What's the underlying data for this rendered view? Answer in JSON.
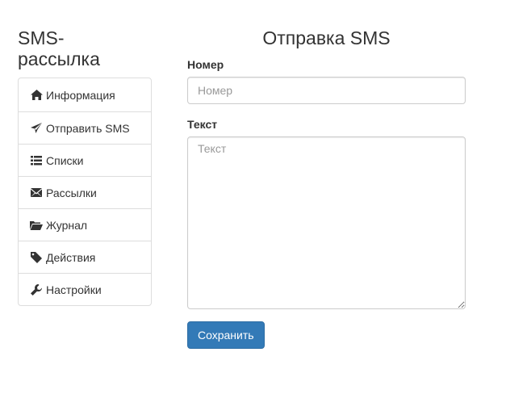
{
  "app": {
    "title": "SMS-рассылка"
  },
  "sidebar": {
    "items": [
      {
        "label": "Информация",
        "icon": "home-icon"
      },
      {
        "label": "Отправить SMS",
        "icon": "send-icon"
      },
      {
        "label": "Списки",
        "icon": "list-icon"
      },
      {
        "label": "Рассылки",
        "icon": "envelope-icon"
      },
      {
        "label": "Журнал",
        "icon": "folder-open-icon"
      },
      {
        "label": "Действия",
        "icon": "tag-icon"
      },
      {
        "label": "Настройки",
        "icon": "wrench-icon"
      }
    ]
  },
  "main": {
    "heading": "Отправка SMS",
    "number_label": "Номер",
    "number_placeholder": "Номер",
    "number_value": "",
    "text_label": "Текст",
    "text_placeholder": "Текст",
    "text_value": "",
    "save_label": "Сохранить"
  },
  "colors": {
    "primary": "#337ab7",
    "border": "#dddddd",
    "text": "#333333",
    "placeholder": "#999999"
  }
}
